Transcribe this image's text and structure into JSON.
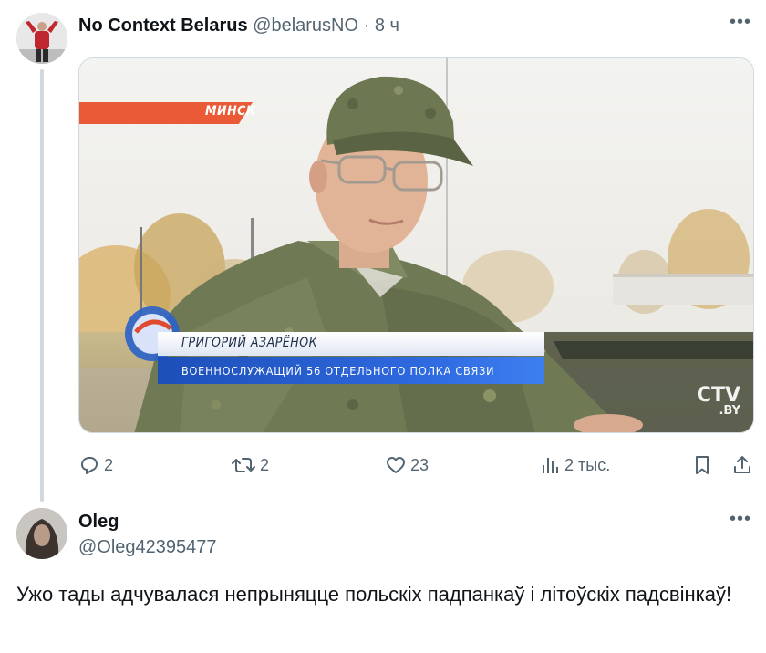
{
  "tweet": {
    "author_name": "No Context Belarus",
    "author_handle": "@belarusNO",
    "separator": "·",
    "time": "8 ч",
    "more_icon": "more-dots-icon",
    "media": {
      "location_label": "МИНСК",
      "person_name": "ГРИГОРИЙ АЗАРЁНОК",
      "person_title": "ВОЕННОСЛУЖАЩИЙ 56 ОТДЕЛЬНОГО ПОЛКА СВЯЗИ",
      "watermark_main": "CTV",
      "watermark_sub": ".BY"
    },
    "actions": {
      "replies": "2",
      "retweets": "2",
      "likes": "23",
      "views": "2 тыс."
    }
  },
  "reply": {
    "author_name": "Oleg",
    "author_handle": "@Oleg42395477",
    "text": "Ужо тады адчувалася непрыняцце польскіх падпанкаў і літоўскіх падсвінкаў!"
  },
  "colors": {
    "text": "#0f1419",
    "secondary": "#536471",
    "thread_line": "#cfd9de",
    "banner_orange": "#ea5a36",
    "lower_third_blue": "#2f6ae0"
  }
}
